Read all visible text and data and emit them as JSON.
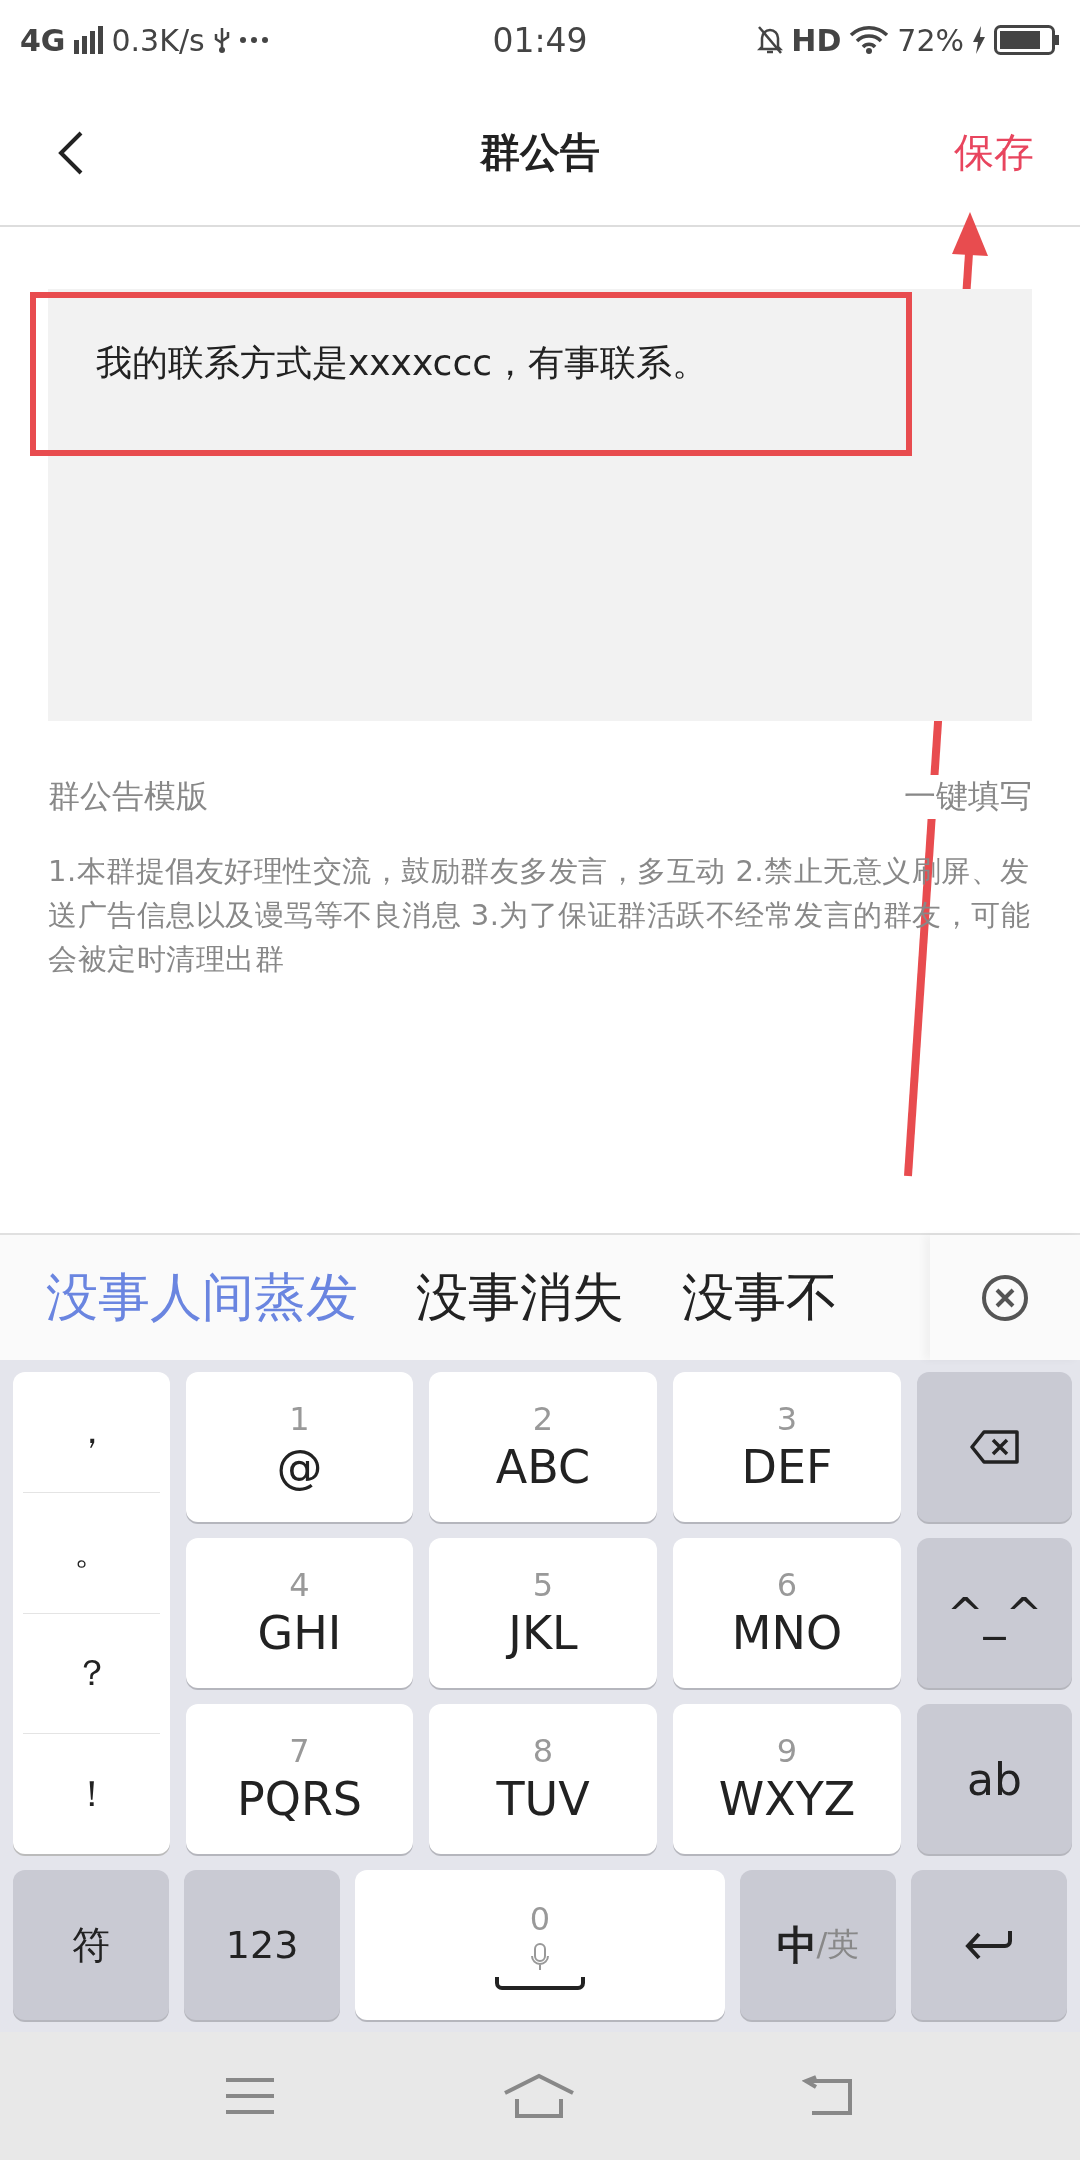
{
  "status_bar": {
    "network": "4G",
    "speed": "0.3K/s",
    "time": "01:49",
    "hd": "HD",
    "battery": "72%"
  },
  "header": {
    "title": "群公告",
    "save": "保存"
  },
  "announcement": {
    "value": "我的联系方式是xxxxccc，有事联系。"
  },
  "template": {
    "label": "群公告模版",
    "fill_button": "一键填写",
    "text": "1.本群提倡友好理性交流，鼓励群友多发言，多互动 2.禁止无意义刷屏、发送广告信息以及谩骂等不良消息 3.为了保证群活跃不经常发言的群友，可能会被定时清理出群"
  },
  "candidates": [
    {
      "text": "没事人间蒸发",
      "selected": true
    },
    {
      "text": "没事消失",
      "selected": false
    },
    {
      "text": "没事不",
      "selected": false
    }
  ],
  "keyboard": {
    "symbols": [
      "，",
      "。",
      "？",
      "！"
    ],
    "rows": [
      {
        "keys": [
          {
            "digit": "1",
            "letters": "@"
          },
          {
            "digit": "2",
            "letters": "ABC"
          },
          {
            "digit": "3",
            "letters": "DEF"
          }
        ],
        "side": {
          "kind": "delete"
        }
      },
      {
        "keys": [
          {
            "digit": "4",
            "letters": "GHI"
          },
          {
            "digit": "5",
            "letters": "JKL"
          },
          {
            "digit": "6",
            "letters": "MNO"
          }
        ],
        "side": {
          "kind": "label",
          "label": "^_^"
        }
      },
      {
        "keys": [
          {
            "digit": "7",
            "letters": "PQRS"
          },
          {
            "digit": "8",
            "letters": "TUV"
          },
          {
            "digit": "9",
            "letters": "WXYZ"
          }
        ],
        "side": {
          "kind": "label",
          "label": "ab"
        }
      }
    ],
    "bottom": [
      {
        "kind": "label",
        "label": "符"
      },
      {
        "kind": "label",
        "label": "123"
      },
      {
        "kind": "space",
        "digit": "0"
      },
      {
        "kind": "lang",
        "primary": "中",
        "secondary": "/英"
      },
      {
        "kind": "enter"
      }
    ]
  }
}
